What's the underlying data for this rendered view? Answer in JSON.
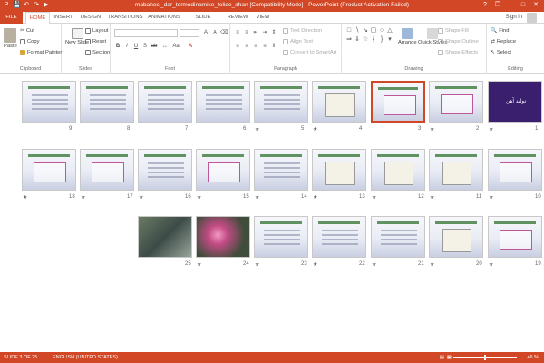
{
  "window": {
    "title": "mabahesi_dar_termodinamike_tolide_ahan [Compatibility Mode] - PowerPoint (Product Activation Failed)",
    "controls": [
      "?",
      "❐",
      "—",
      "□",
      "✕"
    ]
  },
  "tabs": [
    "FILE",
    "HOME",
    "INSERT",
    "DESIGN",
    "TRANSITIONS",
    "ANIMATIONS",
    "SLIDE SHOW",
    "REVIEW",
    "VIEW"
  ],
  "active_tab": "HOME",
  "account": {
    "sign_in": "Sign in"
  },
  "ribbon": {
    "clipboard": {
      "label": "Clipboard",
      "paste": "Paste",
      "cut": "Cut",
      "copy": "Copy",
      "format_painter": "Format Painter"
    },
    "slides": {
      "label": "Slides",
      "new_slide": "New Slide",
      "layout": "Layout",
      "reset": "Reset",
      "section": "Section"
    },
    "font": {
      "label": "Font"
    },
    "paragraph": {
      "label": "Paragraph",
      "text_direction": "Text Direction",
      "align_text": "Align Text",
      "convert_smartart": "Convert to SmartArt"
    },
    "drawing": {
      "label": "Drawing",
      "arrange": "Arrange",
      "quick_styles": "Quick Styles",
      "shape_fill": "Shape Fill",
      "shape_outline": "Shape Outline",
      "shape_effects": "Shape Effects"
    },
    "editing": {
      "label": "Editing",
      "find": "Find",
      "replace": "Replace",
      "select": "Select"
    }
  },
  "slides": {
    "selected": "3",
    "rows": [
      [
        {
          "num": "9",
          "star": "",
          "kind": "text"
        },
        {
          "num": "8",
          "star": "",
          "kind": "text"
        },
        {
          "num": "7",
          "star": "",
          "kind": "text"
        },
        {
          "num": "6",
          "star": "",
          "kind": "text"
        },
        {
          "num": "5",
          "star": "★",
          "kind": "text"
        },
        {
          "num": "4",
          "star": "★",
          "kind": "graph"
        },
        {
          "num": "3",
          "star": "",
          "kind": "box"
        },
        {
          "num": "2",
          "star": "★",
          "kind": "box"
        },
        {
          "num": "1",
          "star": "★",
          "kind": "dark",
          "text": "تولید آهن"
        }
      ],
      [
        {
          "num": "18",
          "star": "★",
          "kind": "box"
        },
        {
          "num": "17",
          "star": "★",
          "kind": "box"
        },
        {
          "num": "16",
          "star": "★",
          "kind": "text"
        },
        {
          "num": "15",
          "star": "★",
          "kind": "box"
        },
        {
          "num": "14",
          "star": "★",
          "kind": "text"
        },
        {
          "num": "13",
          "star": "★",
          "kind": "graph"
        },
        {
          "num": "12",
          "star": "★",
          "kind": "graph"
        },
        {
          "num": "11",
          "star": "★",
          "kind": "graph"
        },
        {
          "num": "10",
          "star": "★",
          "kind": "box"
        }
      ],
      [
        {
          "num": "25",
          "star": "",
          "kind": "photo1"
        },
        {
          "num": "24",
          "star": "★",
          "kind": "photo2"
        },
        {
          "num": "23",
          "star": "★",
          "kind": "text"
        },
        {
          "num": "22",
          "star": "★",
          "kind": "text"
        },
        {
          "num": "21",
          "star": "★",
          "kind": "text"
        },
        {
          "num": "20",
          "star": "★",
          "kind": "graph"
        },
        {
          "num": "19",
          "star": "★",
          "kind": "box"
        }
      ]
    ]
  },
  "status": {
    "slide_info": "SLIDE 3 OF 25",
    "language": "ENGLISH (UNITED STATES)",
    "zoom": "46 %"
  },
  "colors": {
    "accent": "#d24726"
  }
}
